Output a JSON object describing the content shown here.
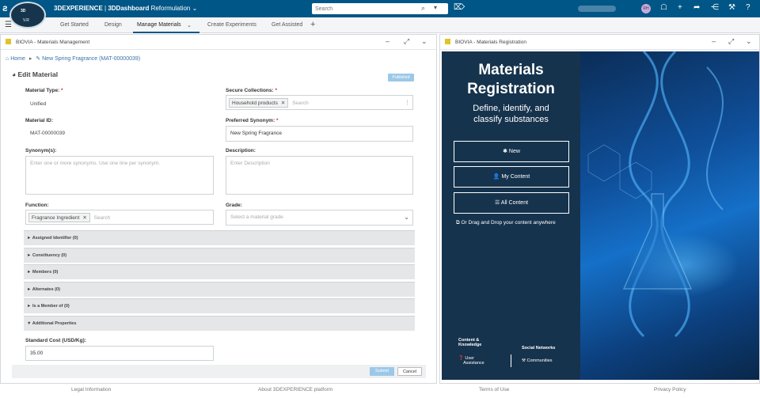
{
  "app": {
    "brand": "3DEXPERIENCE",
    "platform_label": "3DDashboard",
    "dashboard": "Reformulation",
    "compass_top": "3D",
    "compass_bottom": "V.R",
    "search_placeholder": "Search",
    "user_initials": "RH",
    "notification_count": "6"
  },
  "tabs": [
    {
      "label": "Get Started"
    },
    {
      "label": "Design"
    },
    {
      "label": "Manage Materials"
    },
    {
      "label": "Create Experiments"
    },
    {
      "label": "Get Assisted"
    }
  ],
  "left_panel": {
    "title": "BIOVIA - Materials Management",
    "breadcrumb": {
      "home": "Home",
      "current": "New Spring Fragrance (MAT-00000039)"
    },
    "heading": "Edit Material",
    "status_badge": "Published",
    "fields": {
      "material_type": {
        "label": "Material Type:",
        "required": "*",
        "value": "Unified"
      },
      "secure_collections": {
        "label": "Secure Collections:",
        "required": "*",
        "chip": "Household products",
        "placeholder": "Search"
      },
      "material_id": {
        "label": "Material ID:",
        "value": "MAT-00000039"
      },
      "preferred_synonym": {
        "label": "Preferred Synonym:",
        "required": "*",
        "value": "New Spring Fragrance"
      },
      "synonyms": {
        "label": "Synonym(s):",
        "placeholder": "Enter one or more synonyms. Use one line per synonym."
      },
      "description": {
        "label": "Description:",
        "placeholder": "Enter Description"
      },
      "function": {
        "label": "Function:",
        "chip": "Fragrance Ingredient",
        "placeholder": "Search"
      },
      "grade": {
        "label": "Grade:",
        "placeholder": "Select a material grade"
      }
    },
    "sections": [
      {
        "label": "Assigned Identifier (0)",
        "expanded": false
      },
      {
        "label": "Constituency (0)",
        "expanded": false
      },
      {
        "label": "Members (0)",
        "expanded": false
      },
      {
        "label": "Alternates (0)",
        "expanded": false
      },
      {
        "label": "Is a Member of (0)",
        "expanded": false
      },
      {
        "label": "Additional Properties",
        "expanded": true
      }
    ],
    "standard_cost": {
      "label": "Standard Cost (USD/Kg):",
      "value": "35.00"
    },
    "buttons": {
      "submit": "Submit",
      "cancel": "Cancel"
    }
  },
  "right_panel": {
    "title": "BIOVIA - Materials Registration",
    "hero_title_line1": "Materials",
    "hero_title_line2": "Registration",
    "hero_subtitle_line1": "Define, identify, and",
    "hero_subtitle_line2": "classify substances",
    "buttons": [
      {
        "label": "New",
        "icon": "asterisk-icon"
      },
      {
        "label": "My Content",
        "icon": "user-icon"
      },
      {
        "label": "All Content",
        "icon": "list-icon"
      }
    ],
    "drag_text": "Or Drag and Drop your content anywhere",
    "bottom": {
      "content_heading_1": "Content &",
      "content_heading_2": "Knowledge",
      "user_assistance_1": "User",
      "user_assistance_2": "Assistance",
      "social_heading": "Social Networks",
      "communities": "Communities"
    }
  },
  "footer": {
    "legal": "Legal Information",
    "about": "About 3DEXPERIENCE platform",
    "terms": "Terms of Use",
    "privacy": "Privacy Policy"
  },
  "colors": {
    "topbar": "#005686",
    "accent": "#005686",
    "hero_bg": "#16334d",
    "badge": "#9cc8e8"
  }
}
